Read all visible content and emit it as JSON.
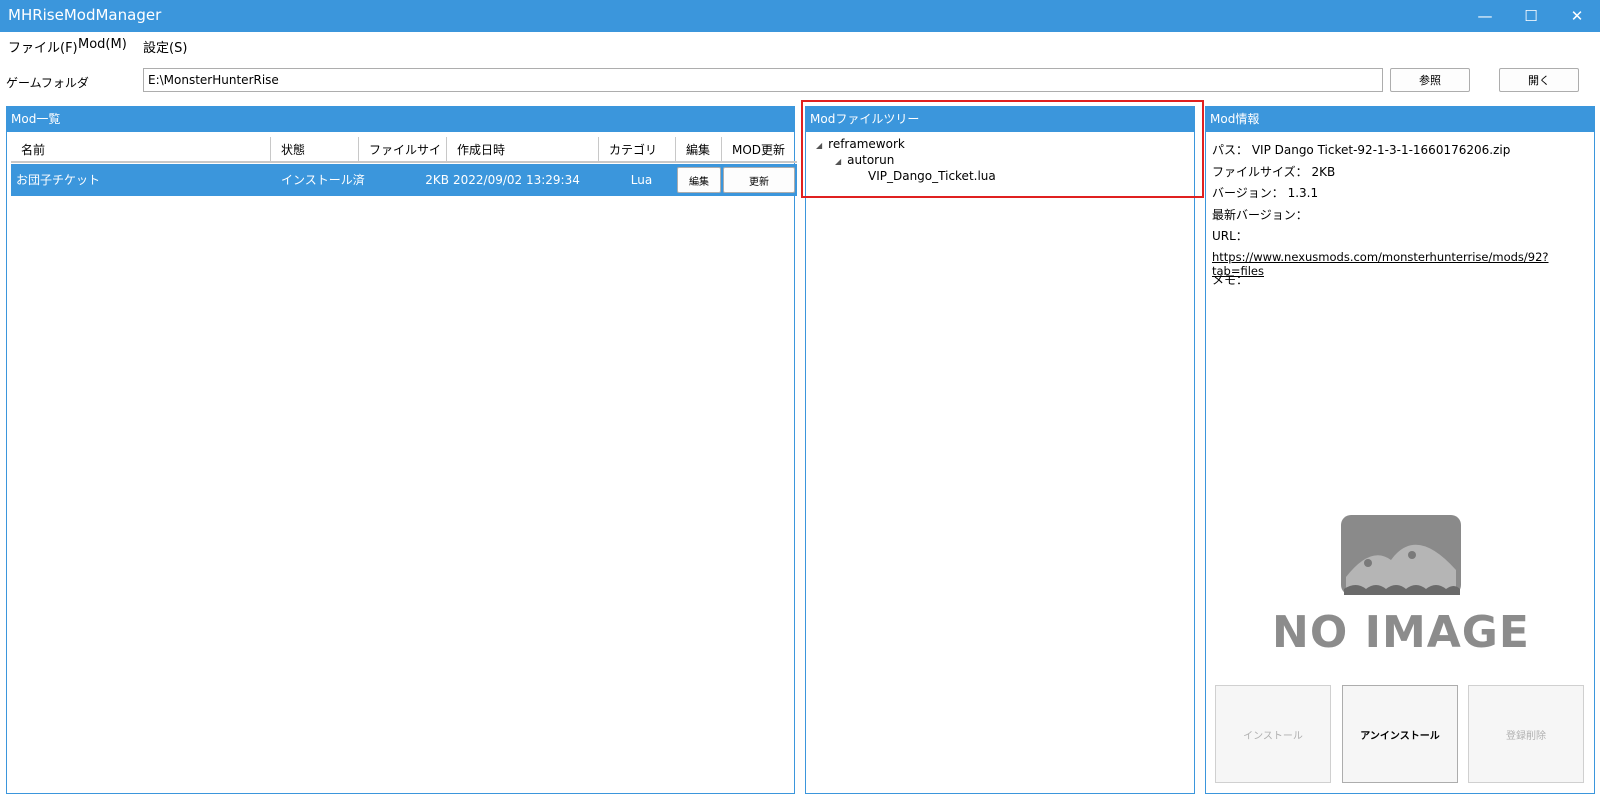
{
  "window": {
    "title": "MHRiseModManager",
    "minimize": "—",
    "maximize": "☐",
    "close": "✕"
  },
  "menu": [
    "ファイル(F)",
    "Mod(M)",
    "設定(S)"
  ],
  "game_folder": {
    "label": "ゲームフォルダ",
    "value": "E:\\MonsterHunterRise",
    "browse_button": "参照",
    "open_button": "開く"
  },
  "mod_list": {
    "header": "Mod一覧",
    "columns": [
      "名前",
      "状態",
      "ファイルサイズ",
      "作成日時",
      "カテゴリ",
      "編集",
      "MOD更新"
    ],
    "rows": [
      {
        "name": "お団子チケット",
        "status": "インストール済",
        "size": "2KB",
        "created": "2022/09/02 13:29:34",
        "category": "Lua",
        "edit_label": "編集",
        "update_label": "更新"
      }
    ]
  },
  "file_tree": {
    "header": "Modファイルツリー",
    "nodes": {
      "root": "reframework",
      "child": "autorun",
      "file": "VIP_Dango_Ticket.lua"
    }
  },
  "mod_info": {
    "header": "Mod情報",
    "path": "パス：  VIP Dango Ticket-92-1-3-1-1660176206.zip",
    "size": "ファイルサイズ：  2KB",
    "version": "バージョン：  1.3.1",
    "latest_version": "最新バージョン：",
    "url_label": "URL：",
    "url": "https://www.nexusmods.com/monsterhunterrise/mods/92?tab=files",
    "memo": "メモ：",
    "no_image": "NO IMAGE",
    "install_button": "インストール",
    "uninstall_button": "アンインストール",
    "delete_button": "登録削除"
  },
  "colors": {
    "accent": "#3b96dc",
    "highlight": "#e02020"
  }
}
